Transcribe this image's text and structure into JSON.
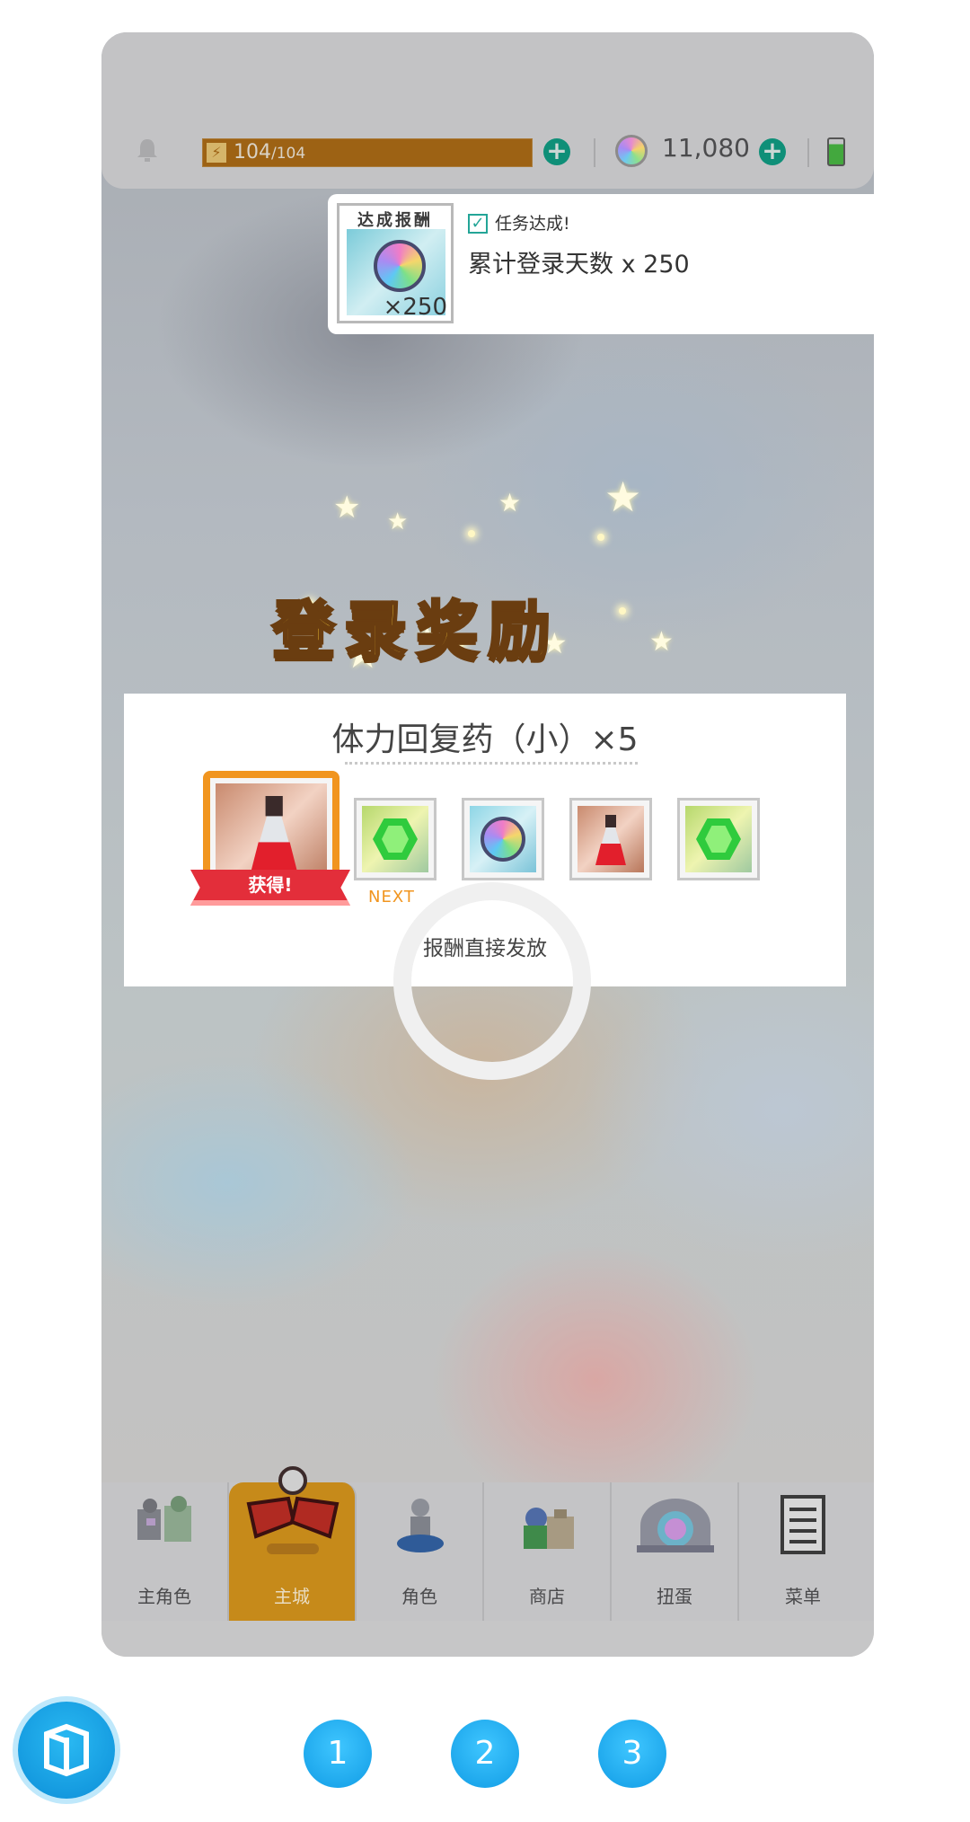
{
  "status_bar": {
    "energy_current": "104",
    "energy_max": "/104",
    "gem_count": "11,080"
  },
  "achievement": {
    "card_title": "达成报酬",
    "card_quantity": "×250",
    "status": "任务达成!",
    "description": "累计登录天数  x 250"
  },
  "login_bonus": {
    "title": "登录奖励",
    "reward_name": "体力回复药（小）×5",
    "obtained_label": "获得!",
    "next_label": "NEXT",
    "delivery_note": "报酬直接发放"
  },
  "tabs": [
    {
      "label": "主角色",
      "icon": "characters-icon"
    },
    {
      "label": "主城",
      "icon": "airship-icon"
    },
    {
      "label": "角色",
      "icon": "knight-icon"
    },
    {
      "label": "商店",
      "icon": "shop-bags-icon"
    },
    {
      "label": "扭蛋",
      "icon": "gacha-portal-icon"
    },
    {
      "label": "菜单",
      "icon": "menu-list-icon"
    }
  ],
  "pager": {
    "pages": [
      "1",
      "2",
      "3"
    ]
  },
  "colors": {
    "accent_orange": "#f1951f",
    "energy_bar": "#9d6214",
    "ribbon_red": "#e32e3a",
    "pager_blue": "#119ce5"
  }
}
